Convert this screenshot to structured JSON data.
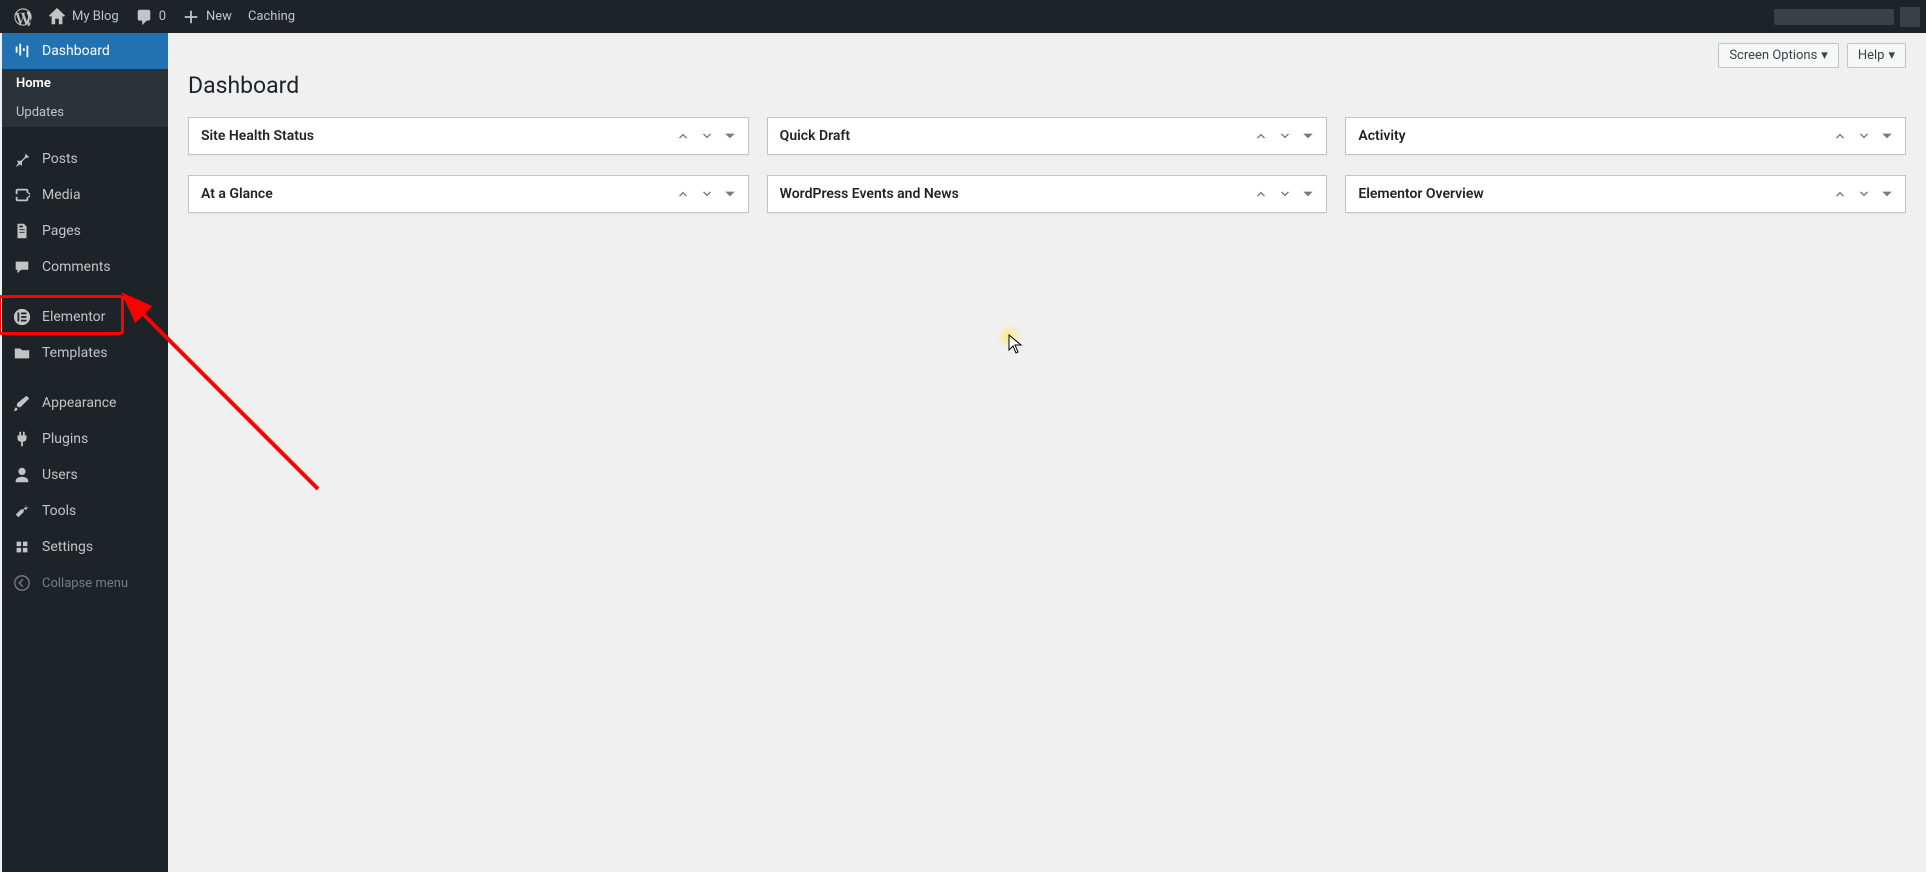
{
  "adminbar": {
    "site_name": "My Blog",
    "comments_count": "0",
    "new_label": "New",
    "caching_label": "Caching"
  },
  "sidebar": {
    "dashboard": "Dashboard",
    "home": "Home",
    "updates": "Updates",
    "posts": "Posts",
    "media": "Media",
    "pages": "Pages",
    "comments": "Comments",
    "elementor": "Elementor",
    "templates": "Templates",
    "appearance": "Appearance",
    "plugins": "Plugins",
    "users": "Users",
    "tools": "Tools",
    "settings": "Settings",
    "collapse": "Collapse menu"
  },
  "page": {
    "title": "Dashboard",
    "screen_options": "Screen Options",
    "help": "Help"
  },
  "metaboxes": {
    "col1": [
      "Site Health Status",
      "At a Glance"
    ],
    "col2": [
      "Quick Draft",
      "WordPress Events and News"
    ],
    "col3": [
      "Activity",
      "Elementor Overview"
    ]
  },
  "annotation": {
    "highlighted_menu": "Elementor"
  }
}
